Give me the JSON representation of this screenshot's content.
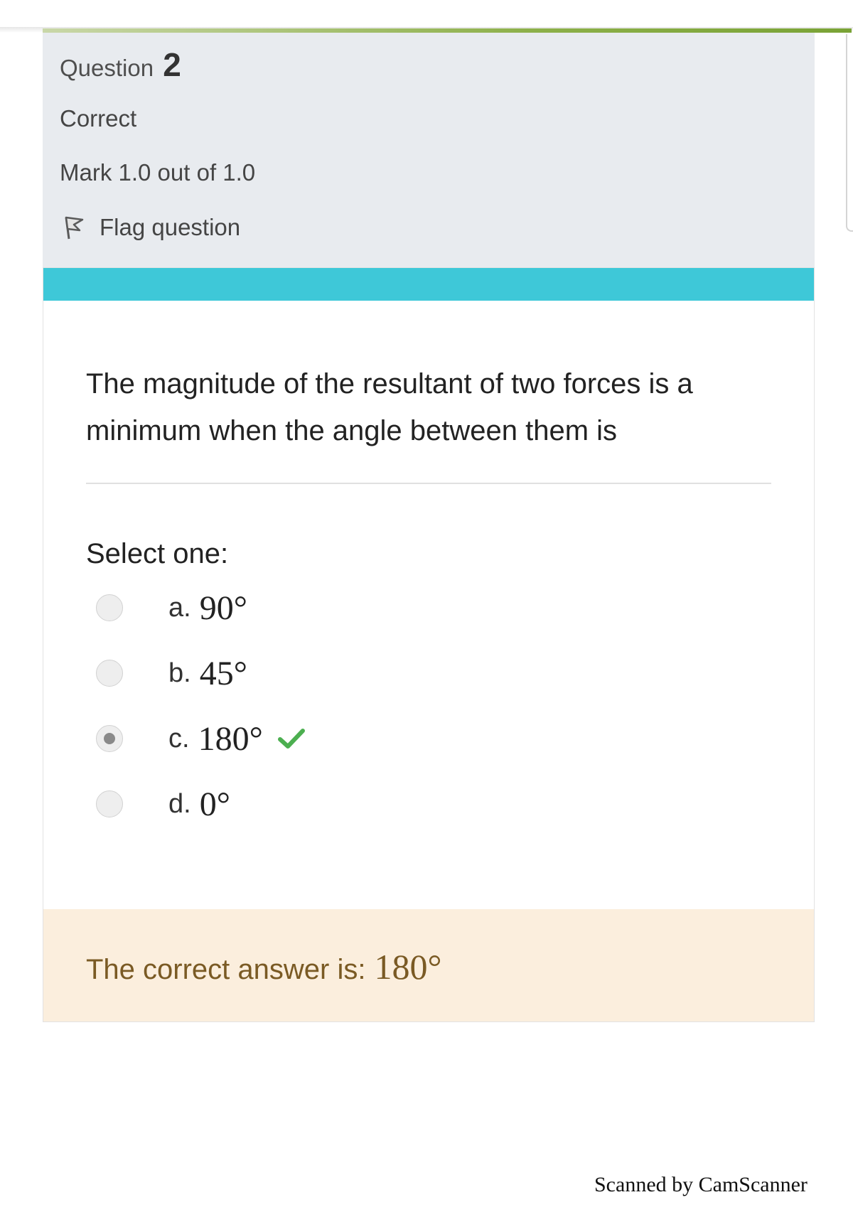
{
  "question": {
    "label": "Question",
    "number": "2",
    "state": "Correct",
    "grade": "Mark 1.0 out of 1.0",
    "flag_label": "Flag question",
    "text": "The magnitude of the resultant of two forces is a minimum when the angle between them is",
    "prompt": "Select one:"
  },
  "options": [
    {
      "letter": "a.",
      "value": "90°",
      "selected": false
    },
    {
      "letter": "b.",
      "value": "45°",
      "selected": false
    },
    {
      "letter": "c.",
      "value": "180°",
      "selected": true,
      "correct": true
    },
    {
      "letter": "d.",
      "value": "0°",
      "selected": false
    }
  ],
  "feedback": {
    "label": "The correct answer is:",
    "answer": "180°"
  },
  "watermark": "Scanned by CamScanner",
  "colors": {
    "accent": "#3ec8d8",
    "info_bg": "#e8ebef",
    "feedback_bg": "#fbeedd",
    "correct": "#4caf50",
    "progress": "#7aa336"
  },
  "icons": {
    "flag": "flag-icon",
    "correct": "checkmark-icon"
  }
}
